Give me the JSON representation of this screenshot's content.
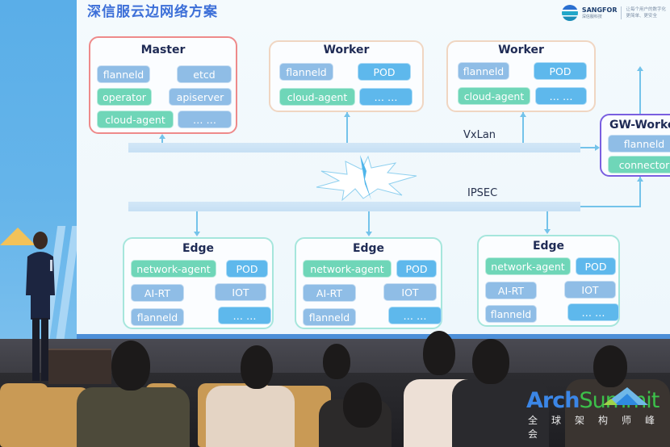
{
  "slide": {
    "title": "深信服云边网络方案",
    "brand": {
      "logo_icon": "sangfor-logo-icon",
      "name": "SANGFOR",
      "name_cn": "深信服科技",
      "slogan_line1": "让每个用户的数字化",
      "slogan_line2": "更简单、更安全"
    },
    "nodes": {
      "master": {
        "title": "Master",
        "chips": [
          {
            "label": "flanneld",
            "kind": "blue"
          },
          {
            "label": "etcd",
            "kind": "blue"
          },
          {
            "label": "operator",
            "kind": "green"
          },
          {
            "label": "apiserver",
            "kind": "blue"
          },
          {
            "label": "cloud-agent",
            "kind": "green"
          },
          {
            "label": "… …",
            "kind": "blue"
          }
        ]
      },
      "worker1": {
        "title": "Worker",
        "chips": [
          {
            "label": "flanneld",
            "kind": "blue"
          },
          {
            "label": "POD",
            "kind": "sky"
          },
          {
            "label": "cloud-agent",
            "kind": "green"
          },
          {
            "label": "… …",
            "kind": "sky"
          }
        ]
      },
      "worker2": {
        "title": "Worker",
        "chips": [
          {
            "label": "flanneld",
            "kind": "blue"
          },
          {
            "label": "POD",
            "kind": "sky"
          },
          {
            "label": "cloud-agent",
            "kind": "green"
          },
          {
            "label": "… …",
            "kind": "sky"
          }
        ]
      },
      "gw_worker": {
        "title": "GW-Worker",
        "chips": [
          {
            "label": "flanneld",
            "kind": "blue"
          },
          {
            "label": "connector",
            "kind": "green"
          }
        ]
      },
      "edges": [
        {
          "title": "Edge",
          "chips": [
            {
              "label": "network-agent",
              "kind": "green"
            },
            {
              "label": "POD",
              "kind": "sky"
            },
            {
              "label": "AI-RT",
              "kind": "blue"
            },
            {
              "label": "IOT",
              "kind": "blue"
            },
            {
              "label": "flanneld",
              "kind": "blue"
            },
            {
              "label": "… …",
              "kind": "sky"
            }
          ]
        },
        {
          "title": "Edge",
          "chips": [
            {
              "label": "network-agent",
              "kind": "green"
            },
            {
              "label": "POD",
              "kind": "sky"
            },
            {
              "label": "AI-RT",
              "kind": "blue"
            },
            {
              "label": "IOT",
              "kind": "blue"
            },
            {
              "label": "flanneld",
              "kind": "blue"
            },
            {
              "label": "… …",
              "kind": "sky"
            }
          ]
        },
        {
          "title": "Edge",
          "chips": [
            {
              "label": "network-agent",
              "kind": "green"
            },
            {
              "label": "POD",
              "kind": "sky"
            },
            {
              "label": "AI-RT",
              "kind": "blue"
            },
            {
              "label": "IOT",
              "kind": "blue"
            },
            {
              "label": "flanneld",
              "kind": "blue"
            },
            {
              "label": "… …",
              "kind": "sky"
            }
          ]
        }
      ]
    },
    "networks": {
      "vxlan_label": "VxLan",
      "ipsec_label": "IPSEC",
      "break_icon": "lightning-burst-icon"
    }
  },
  "event_logo": {
    "name_part1": "Arch",
    "name_part2": "Summit",
    "subtitle": "全球架构师峰会",
    "icon": "mountain-logo-icon"
  },
  "colors": {
    "title_blue": "#3c6fd8",
    "chip_blue": "#8fbde6",
    "chip_sky": "#5eb8ec",
    "chip_green": "#6fd6b8",
    "master_border": "#ee8a8a",
    "gw_border": "#7a5fe0",
    "edge_border": "#a6e6dc"
  }
}
